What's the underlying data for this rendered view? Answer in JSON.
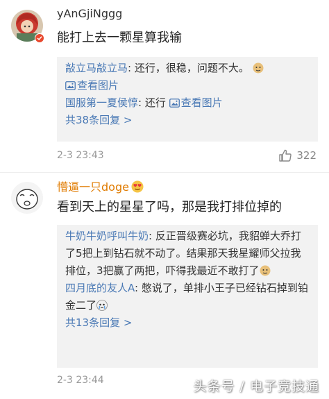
{
  "comments": [
    {
      "username": "yAnGjiNggg",
      "content": "能打上去一颗星算我输",
      "replies": [
        {
          "name": "敲立马敲立马",
          "sep": ": ",
          "text": "还行，很稳，问题不大。",
          "emoji": "doge-emoji",
          "link": "查看图片"
        },
        {
          "name": "国服第一夏侯惇",
          "sep": ": ",
          "text": "还行 ",
          "link": "查看图片"
        }
      ],
      "more": "共38条回复 >",
      "time": "2-3 23:43",
      "likes": "322"
    },
    {
      "username": "懵逼一只doge",
      "content": "看到天上的星星了吗，那是我打排位掉的",
      "replies": [
        {
          "name": "牛奶牛奶呼叫牛奶",
          "sep": ": ",
          "text": "反正晋级赛必坑，我貂蝉大乔打了5把上到钻石就不动了。结果那天我星耀师父拉我排位，3把赢了两把，吓得我最近不敢打了",
          "emoji": "doge-emoji"
        },
        {
          "name": "四月底的友人A",
          "sep": ": ",
          "text": "憋说了，单排小王子已经钻石掉到铂金二了",
          "emoji": "cry-emoji"
        }
      ],
      "more": "共13条回复 >",
      "time": "2-3 23:44"
    }
  ],
  "watermark": "头条号 / 电子竞技通",
  "colors": {
    "link": "#4a79b5",
    "vip_name": "#e07b00",
    "reply_bg": "#f2f2f2",
    "muted": "#999999"
  }
}
